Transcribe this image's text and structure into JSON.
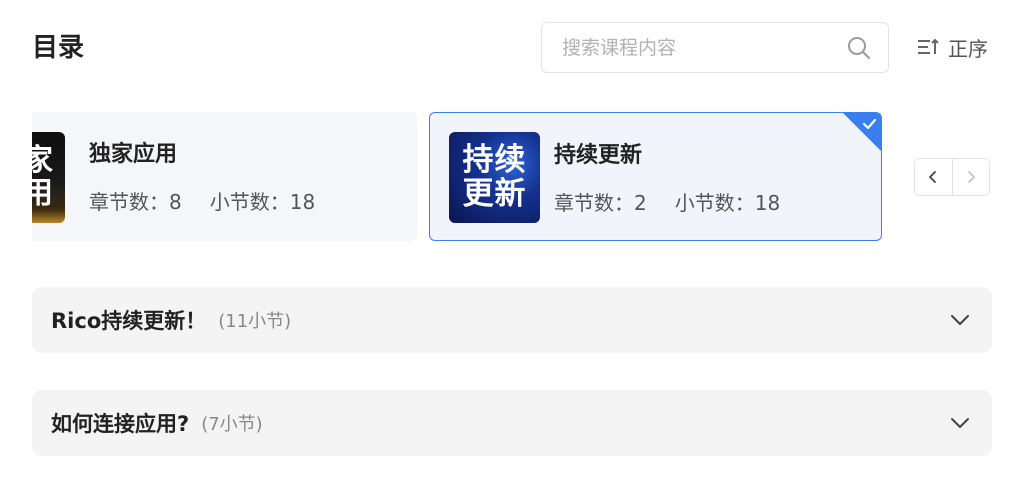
{
  "header": {
    "title": "目录",
    "search_placeholder": "搜索课程内容",
    "sort_label": "正序"
  },
  "cards": [
    {
      "thumb_lines": [
        "家",
        "用"
      ],
      "name": "独家应用",
      "chapters_label": "章节数：8",
      "sections_label": "小节数：18",
      "selected": false
    },
    {
      "thumb_lines": [
        "持续",
        "更新"
      ],
      "name": "持续更新",
      "chapters_label": "章节数：2",
      "sections_label": "小节数：18",
      "selected": true
    }
  ],
  "sections": [
    {
      "title": "Rico持续更新！",
      "count": "(11小节)"
    },
    {
      "title": "如何连接应用?",
      "count": "(7小节)"
    }
  ],
  "icons": {
    "search": "search-icon",
    "sort": "sort-ascending-icon",
    "check": "check-icon",
    "prev": "chevron-left-icon",
    "next": "chevron-right-icon",
    "expand": "chevron-down-icon"
  },
  "colors": {
    "accent": "#3a7ef0",
    "card_bg": "#f5f6f8",
    "selected_card_bg": "#f1f5fb",
    "section_bg": "#f4f4f5"
  }
}
